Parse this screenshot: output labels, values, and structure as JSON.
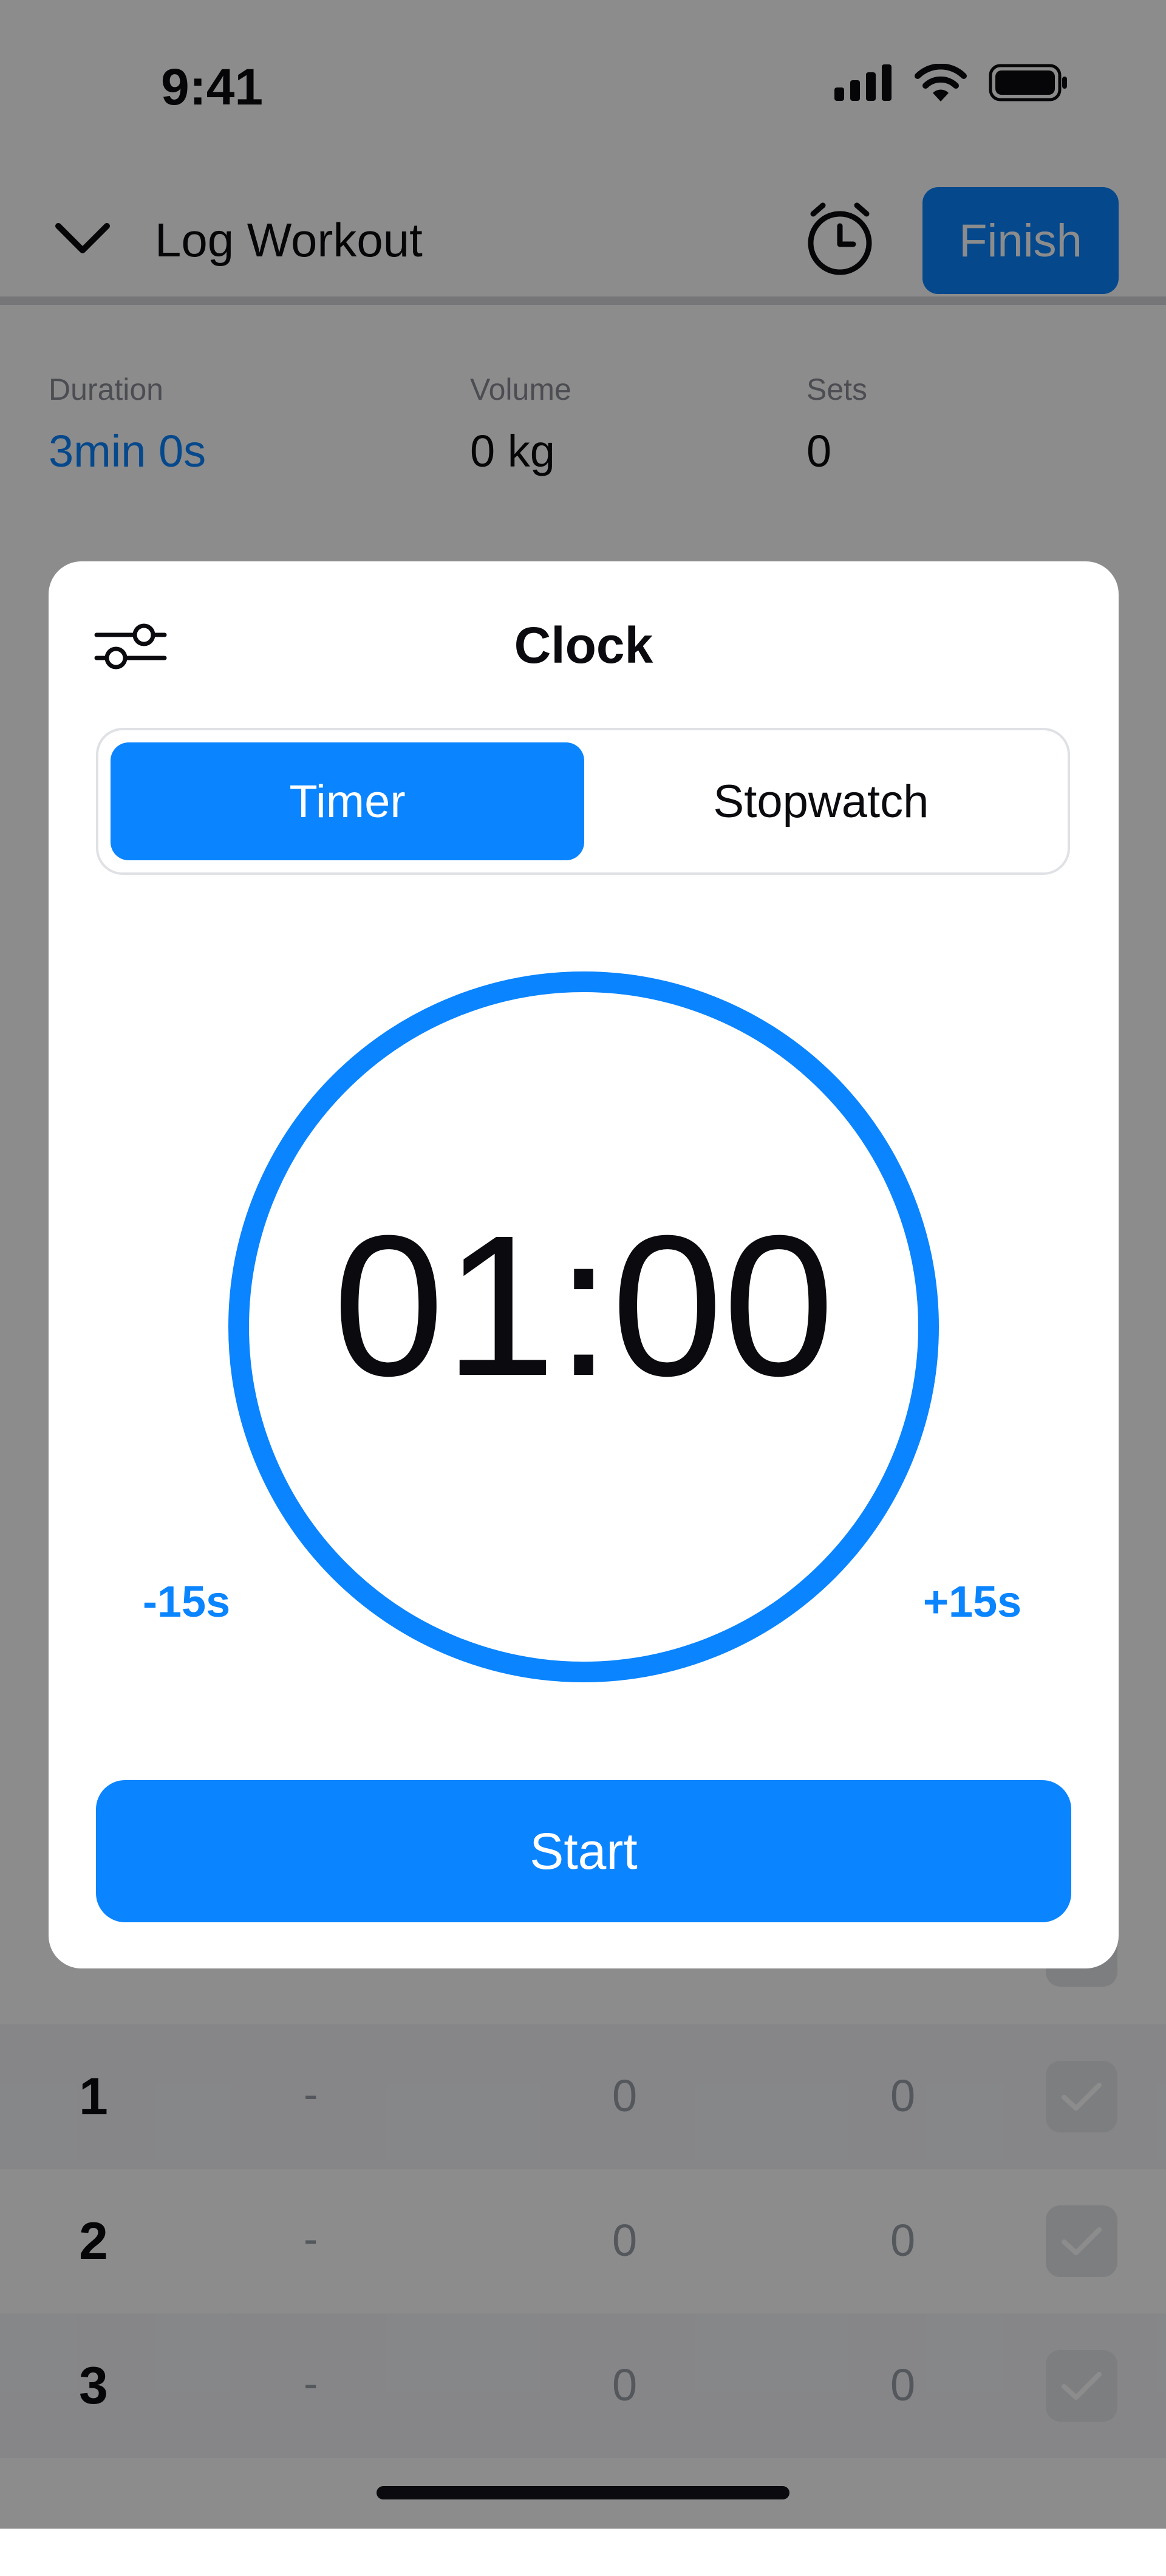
{
  "status_bar": {
    "time": "9:41",
    "icons": [
      "cellular-signal-icon",
      "wifi-icon",
      "battery-icon"
    ]
  },
  "nav": {
    "title": "Log Workout",
    "finish_label": "Finish",
    "icons": [
      "chevron-down-icon",
      "alarm-clock-icon"
    ]
  },
  "stats": [
    {
      "label": "Duration",
      "value": "3min 0s"
    },
    {
      "label": "Volume",
      "value": "0 kg"
    },
    {
      "label": "Sets",
      "value": "0"
    }
  ],
  "sets": [
    {
      "number": "1",
      "previous": "-",
      "kg": "0",
      "reps": "0"
    },
    {
      "number": "2",
      "previous": "-",
      "kg": "0",
      "reps": "0"
    },
    {
      "number": "3",
      "previous": "-",
      "kg": "0",
      "reps": "0"
    }
  ],
  "modal": {
    "title": "Clock",
    "tabs": [
      {
        "label": "Timer",
        "selected": true
      },
      {
        "label": "Stopwatch",
        "selected": false
      }
    ],
    "timer_value": "01:00",
    "minus_label": "-15s",
    "plus_label": "+15s",
    "start_label": "Start",
    "progress": 1.0
  },
  "colors": {
    "accent": "#0a84ff",
    "text": "#0b0b0f",
    "muted": "#9aa0aa"
  }
}
